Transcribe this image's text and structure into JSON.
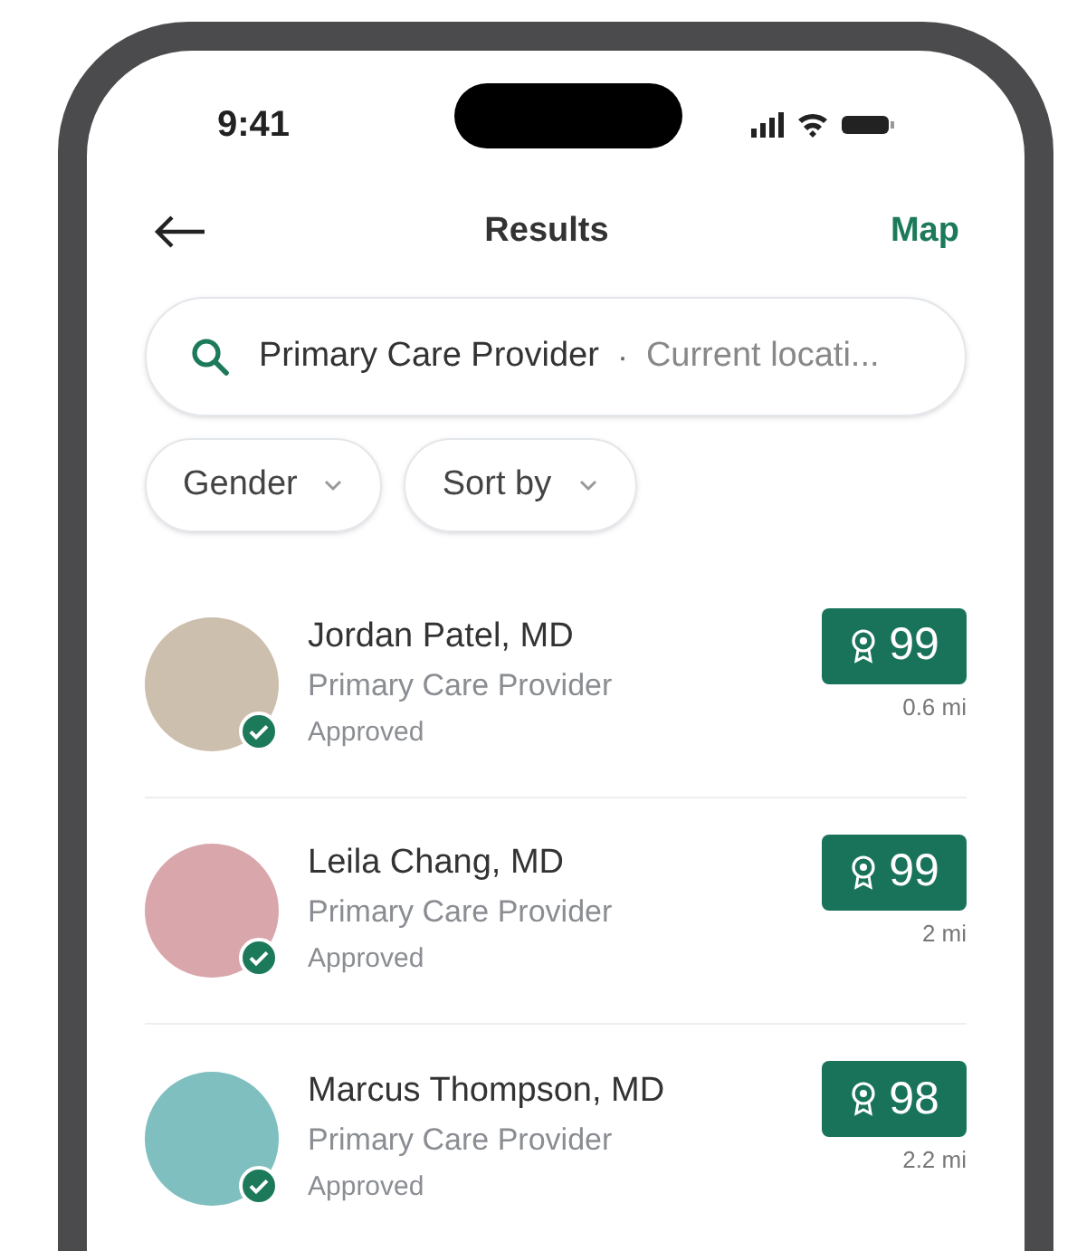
{
  "status_bar": {
    "time": "9:41"
  },
  "header": {
    "title": "Results",
    "action": "Map"
  },
  "search": {
    "query": "Primary Care Provider",
    "separator": "·",
    "location": "Current locati..."
  },
  "filters": [
    {
      "label": "Gender"
    },
    {
      "label": "Sort by"
    }
  ],
  "results": [
    {
      "name": "Jordan Patel, MD",
      "specialty": "Primary Care Provider",
      "status": "Approved",
      "verified": true,
      "score": "99",
      "distance": "0.6 mi"
    },
    {
      "name": "Leila Chang, MD",
      "specialty": "Primary Care Provider",
      "status": "Approved",
      "verified": true,
      "score": "99",
      "distance": "2 mi"
    },
    {
      "name": "Marcus Thompson, MD",
      "specialty": "Primary Care Provider",
      "status": "Approved",
      "verified": true,
      "score": "98",
      "distance": "2.2 mi"
    }
  ]
}
